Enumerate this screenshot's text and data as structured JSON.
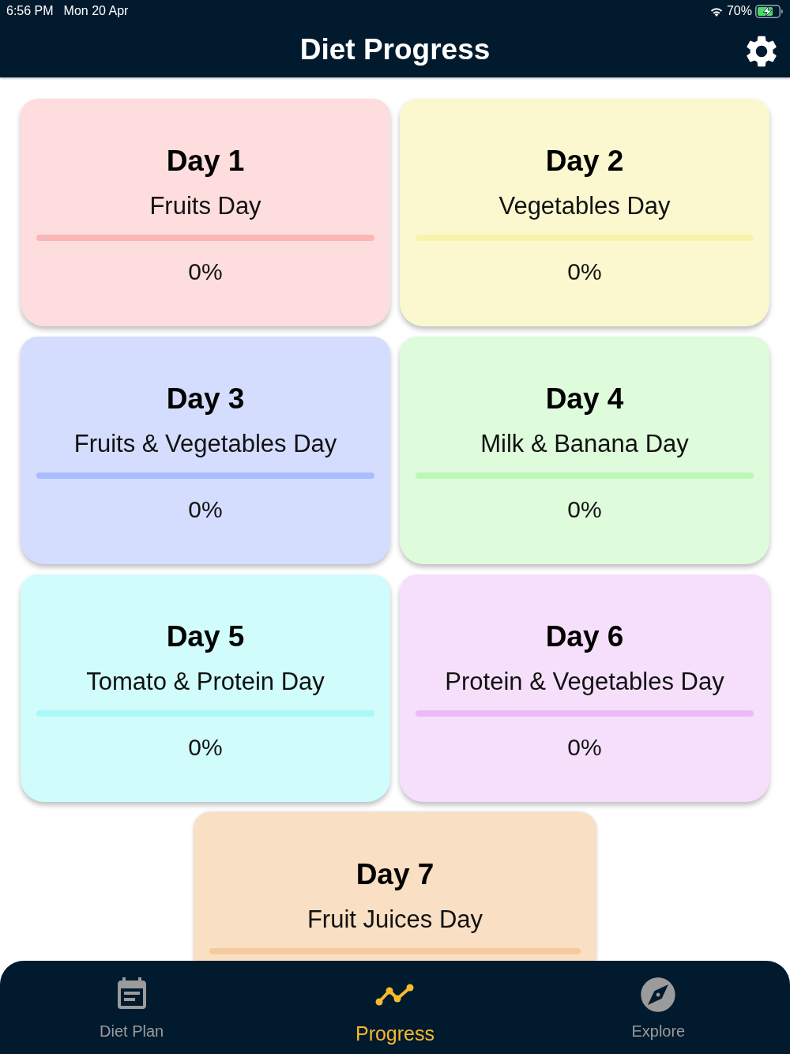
{
  "status_bar": {
    "time": "6:56 PM",
    "date": "Mon 20 Apr",
    "battery": "70%"
  },
  "header": {
    "title": "Diet Progress"
  },
  "cards": [
    {
      "day": "Day 1",
      "name": "Fruits Day",
      "level": 0,
      "percent": "0%",
      "color": "#fddddd"
    },
    {
      "day": "Day 2",
      "name": "Vegetables Day",
      "level": 0,
      "percent": "0%",
      "color": "#fbf8cf"
    },
    {
      "day": "Day 3",
      "name": "Fruits & Vegetables Day",
      "level": 0,
      "percent": "0%",
      "color": "#d4ddfe"
    },
    {
      "day": "Day 4",
      "name": "Milk & Banana Day",
      "level": 0,
      "percent": "0%",
      "color": "#defbdb"
    },
    {
      "day": "Day 5",
      "name": "Tomato & Protein Day",
      "level": 0,
      "percent": "0%",
      "color": "#d0fcfb"
    },
    {
      "day": "Day 6",
      "name": "Protein & Vegetables Day",
      "level": 0,
      "percent": "0%",
      "color": "#f6dffb"
    },
    {
      "day": "Day 7",
      "name": "Fruit Juices Day",
      "level": 0,
      "color": "#f9dfc3"
    }
  ],
  "tab_bar": [
    {
      "label": "Diet Plan",
      "selected": false
    },
    {
      "label": "Progress",
      "selected": true
    },
    {
      "label": "Explore",
      "selected": false
    }
  ]
}
